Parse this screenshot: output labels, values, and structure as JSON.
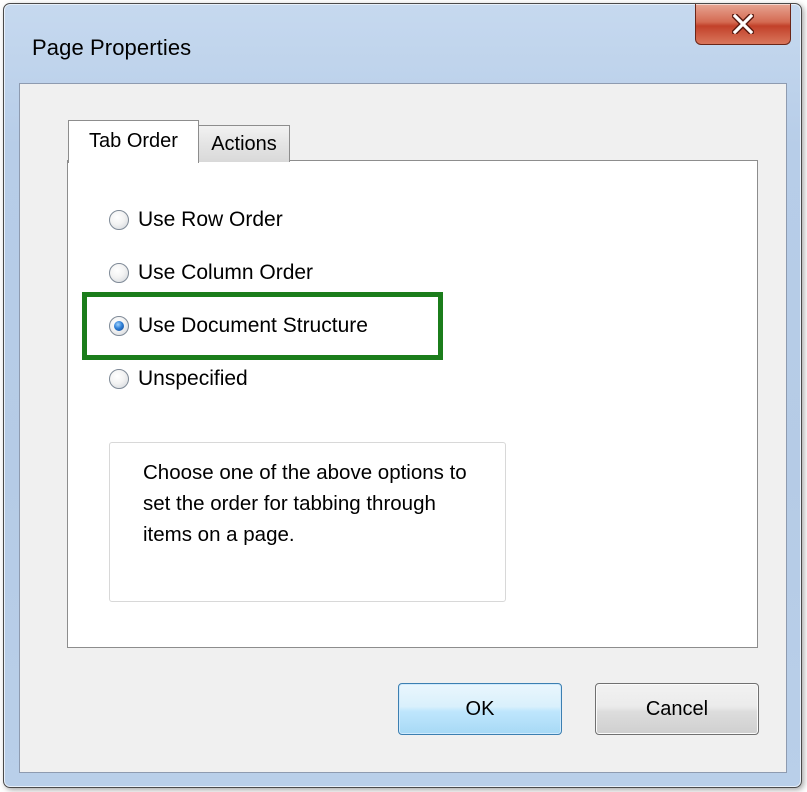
{
  "dialog": {
    "title": "Page Properties",
    "close_icon": "close-icon"
  },
  "tabs": [
    {
      "label": "Tab Order",
      "active": true
    },
    {
      "label": "Actions",
      "active": false
    }
  ],
  "tab_order": {
    "options": [
      {
        "label": "Use Row Order",
        "checked": false
      },
      {
        "label": "Use Column Order",
        "checked": false
      },
      {
        "label": "Use Document Structure",
        "checked": true
      },
      {
        "label": "Unspecified",
        "checked": false
      }
    ],
    "help_text": "Choose one of the above options to set the order for tabbing through items on a page."
  },
  "buttons": {
    "ok_label": "OK",
    "cancel_label": "Cancel"
  },
  "colors": {
    "highlight": "#1b7d1b",
    "close_button": "#c2412a",
    "selected_radio": "#2f7fd6"
  }
}
